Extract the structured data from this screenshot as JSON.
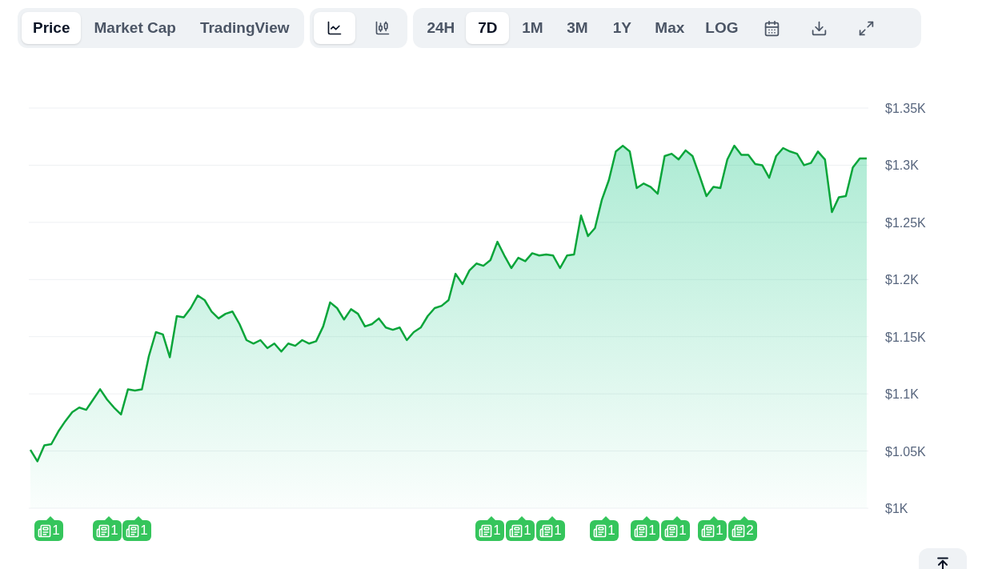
{
  "chart_tabs": [
    {
      "label": "Price",
      "selected": true
    },
    {
      "label": "Market Cap",
      "selected": false
    },
    {
      "label": "TradingView",
      "selected": false
    }
  ],
  "view_buttons": [
    {
      "kind": "line",
      "selected": true
    },
    {
      "kind": "candlestick",
      "selected": false
    }
  ],
  "ranges": [
    {
      "label": "24H",
      "selected": false
    },
    {
      "label": "7D",
      "selected": true
    },
    {
      "label": "1M",
      "selected": false
    },
    {
      "label": "3M",
      "selected": false
    },
    {
      "label": "1Y",
      "selected": false
    },
    {
      "label": "Max",
      "selected": false
    },
    {
      "label": "LOG",
      "selected": false
    }
  ],
  "tools": [
    {
      "kind": "calendar"
    },
    {
      "kind": "download"
    },
    {
      "kind": "expand"
    }
  ],
  "chart_data": {
    "type": "area",
    "ylim": [
      1000,
      1350
    ],
    "yticks": [
      {
        "value": 1000,
        "label": "$1K"
      },
      {
        "value": 1050,
        "label": "$1.05K"
      },
      {
        "value": 1100,
        "label": "$1.1K"
      },
      {
        "value": 1150,
        "label": "$1.15K"
      },
      {
        "value": 1200,
        "label": "$1.2K"
      },
      {
        "value": 1250,
        "label": "$1.25K"
      },
      {
        "value": 1300,
        "label": "$1.3K"
      },
      {
        "value": 1350,
        "label": "$1.35K"
      }
    ],
    "grid": true,
    "series": [
      {
        "color": "#0aa53a",
        "values": [
          1051,
          1041,
          1055,
          1056,
          1067,
          1076,
          1084,
          1088,
          1086,
          1095,
          1104,
          1095,
          1088,
          1082,
          1104,
          1103,
          1104,
          1133,
          1154,
          1152,
          1132,
          1168,
          1167,
          1175,
          1186,
          1182,
          1172,
          1166,
          1170,
          1172,
          1161,
          1147,
          1144,
          1147,
          1140,
          1144,
          1137,
          1144,
          1142,
          1147,
          1144,
          1146,
          1159,
          1180,
          1175,
          1165,
          1174,
          1170,
          1159,
          1161,
          1166,
          1158,
          1156,
          1158,
          1147,
          1154,
          1158,
          1168,
          1175,
          1177,
          1182,
          1205,
          1196,
          1208,
          1214,
          1212,
          1217,
          1233,
          1221,
          1210,
          1219,
          1216,
          1223,
          1221,
          1222,
          1221,
          1210,
          1221,
          1222,
          1256,
          1238,
          1245,
          1270,
          1287,
          1312,
          1317,
          1312,
          1280,
          1284,
          1281,
          1275,
          1308,
          1310,
          1305,
          1313,
          1308,
          1291,
          1273,
          1281,
          1280,
          1305,
          1317,
          1309,
          1309,
          1301,
          1300,
          1289,
          1308,
          1315,
          1312,
          1310,
          1300,
          1302,
          1312,
          1305,
          1259,
          1272,
          1273,
          1298,
          1306,
          1306
        ]
      }
    ]
  },
  "news_markers": [
    {
      "count": "1"
    },
    {
      "count": "1"
    },
    {
      "count": "1"
    },
    {
      "count": "1"
    },
    {
      "count": "1"
    },
    {
      "count": "1"
    },
    {
      "count": "1"
    },
    {
      "count": "1"
    },
    {
      "count": "1"
    },
    {
      "count": "1"
    },
    {
      "count": "2"
    }
  ]
}
